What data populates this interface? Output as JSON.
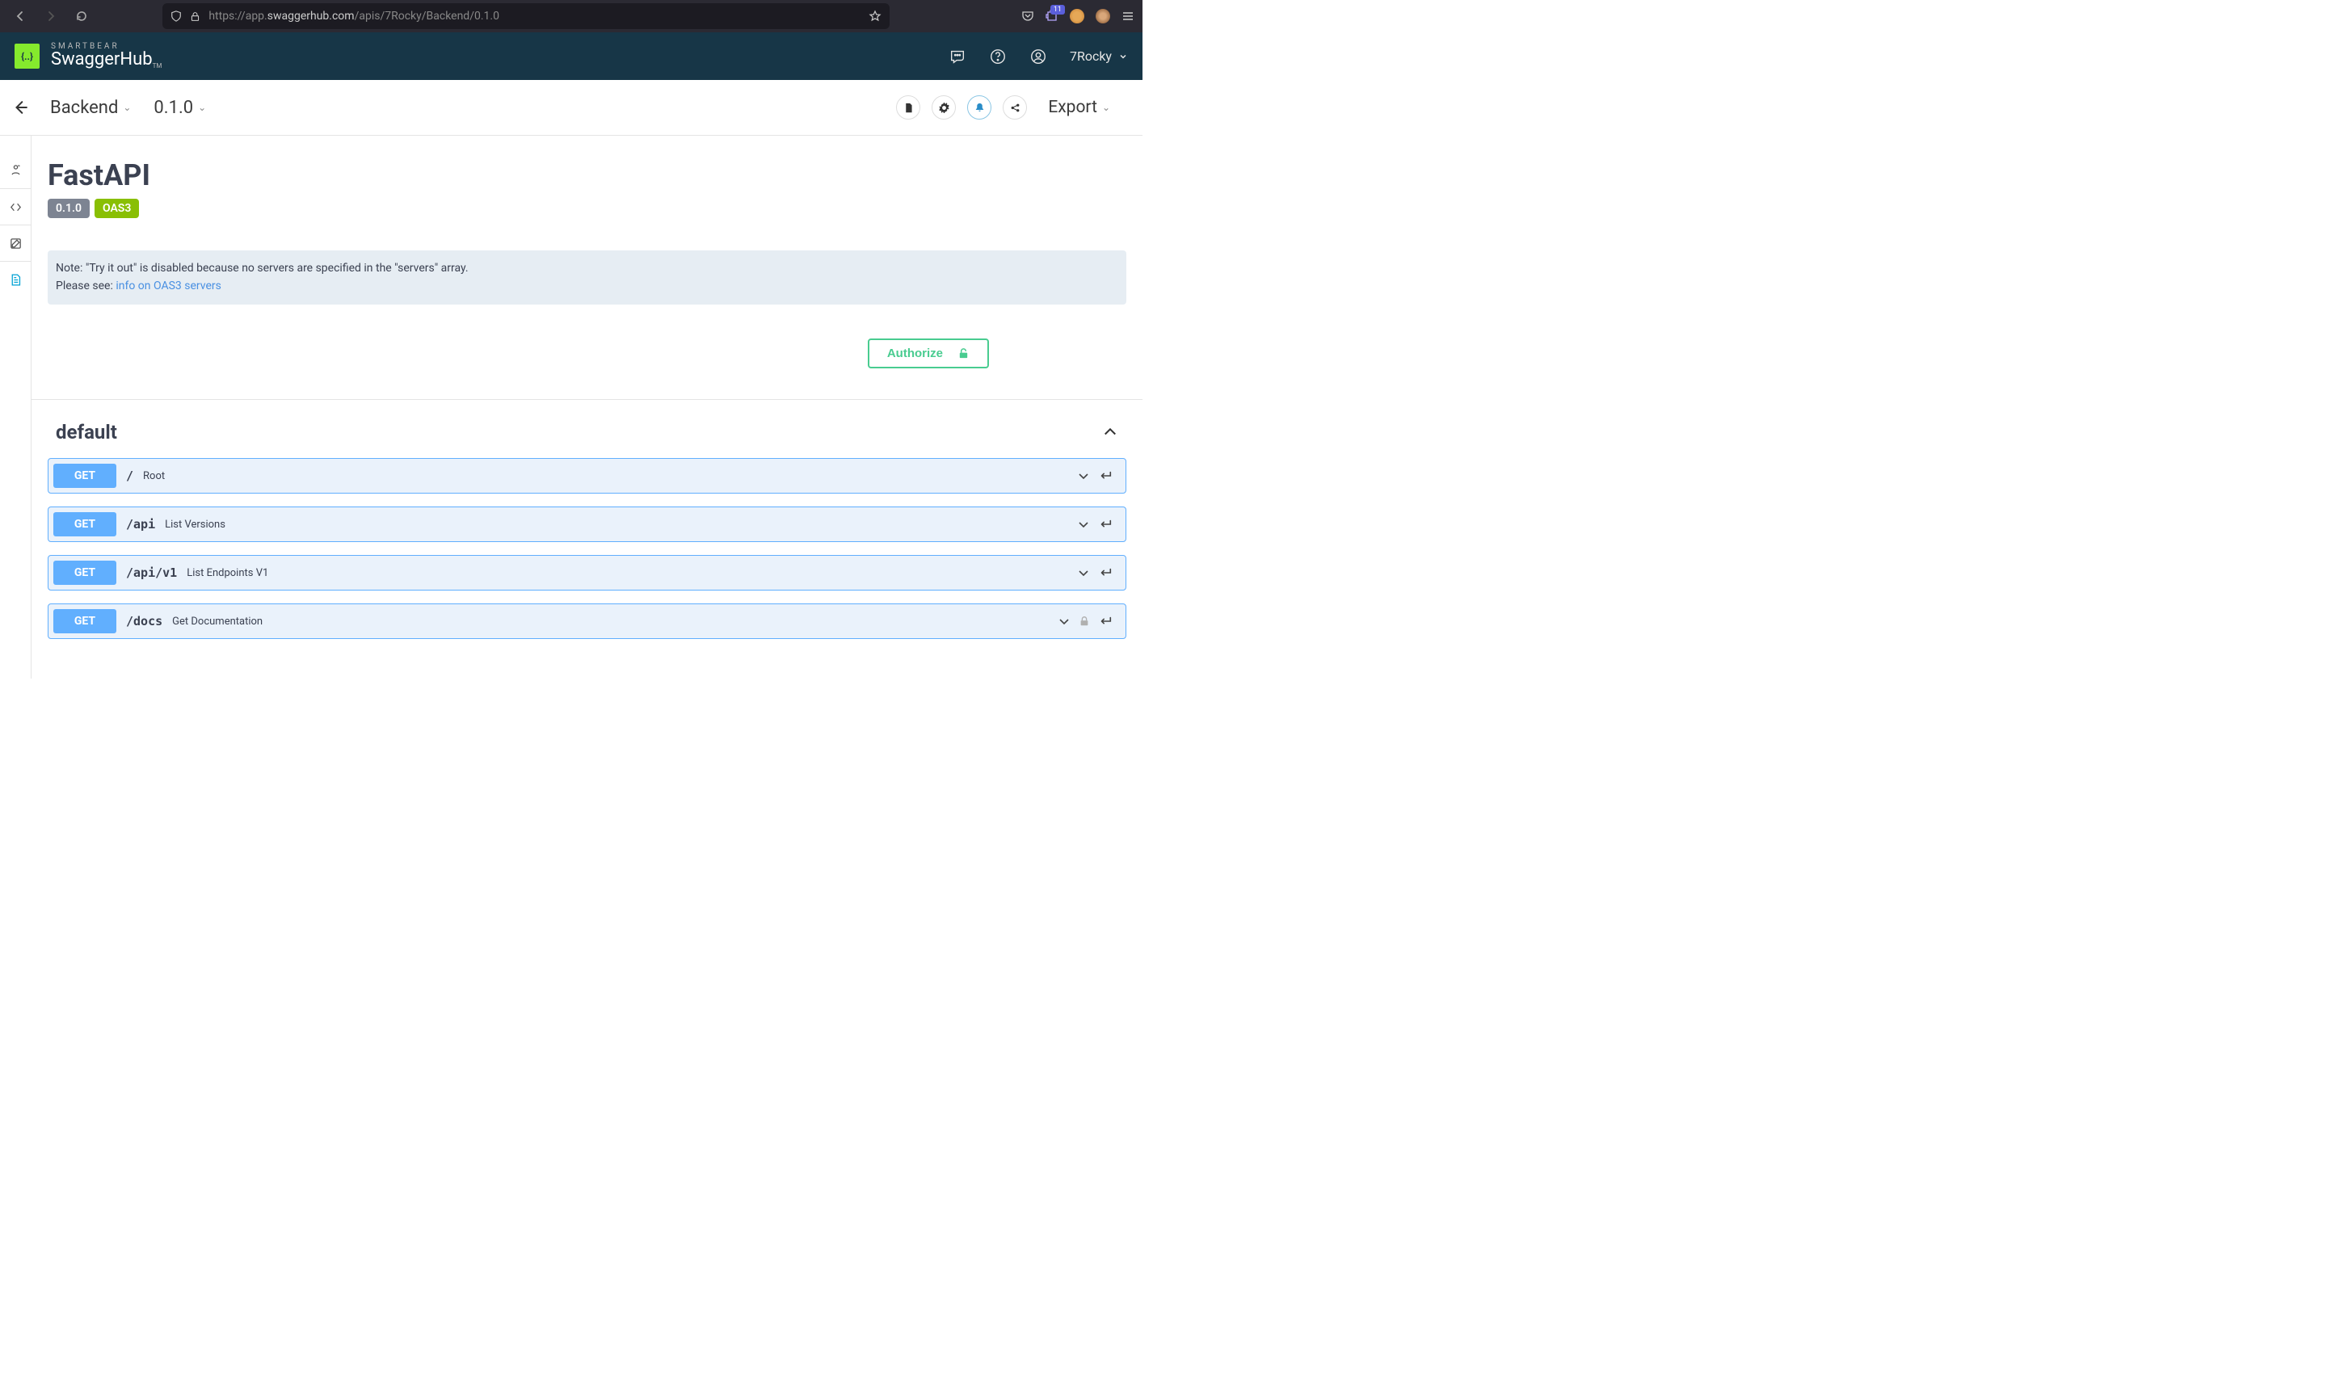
{
  "browser": {
    "url_prefix": "https://app.",
    "url_domain": "swaggerhub.com",
    "url_path": "/apis/7Rocky/Backend/0.1.0",
    "badge_count": "11"
  },
  "appbar": {
    "brand_small": "SMARTBEAR",
    "brand_big": "SwaggerHub",
    "brand_tm": "TM",
    "username": "7Rocky"
  },
  "subbar": {
    "api_name": "Backend",
    "version": "0.1.0",
    "export": "Export"
  },
  "doc": {
    "title": "FastAPI",
    "version_badge": "0.1.0",
    "oas_badge": "OAS3",
    "note_line1": "Note: \"Try it out\" is disabled because no servers are specified in the \"servers\" array.",
    "note_line2_prefix": "Please see: ",
    "note_link": "info on OAS3 servers",
    "authorize": "Authorize",
    "tag": "default",
    "ops": [
      {
        "method": "GET",
        "path": "/",
        "summary": "Root",
        "locked": false
      },
      {
        "method": "GET",
        "path": "/api",
        "summary": "List Versions",
        "locked": false
      },
      {
        "method": "GET",
        "path": "/api/v1",
        "summary": "List Endpoints V1",
        "locked": false
      },
      {
        "method": "GET",
        "path": "/docs",
        "summary": "Get Documentation",
        "locked": true
      }
    ]
  }
}
